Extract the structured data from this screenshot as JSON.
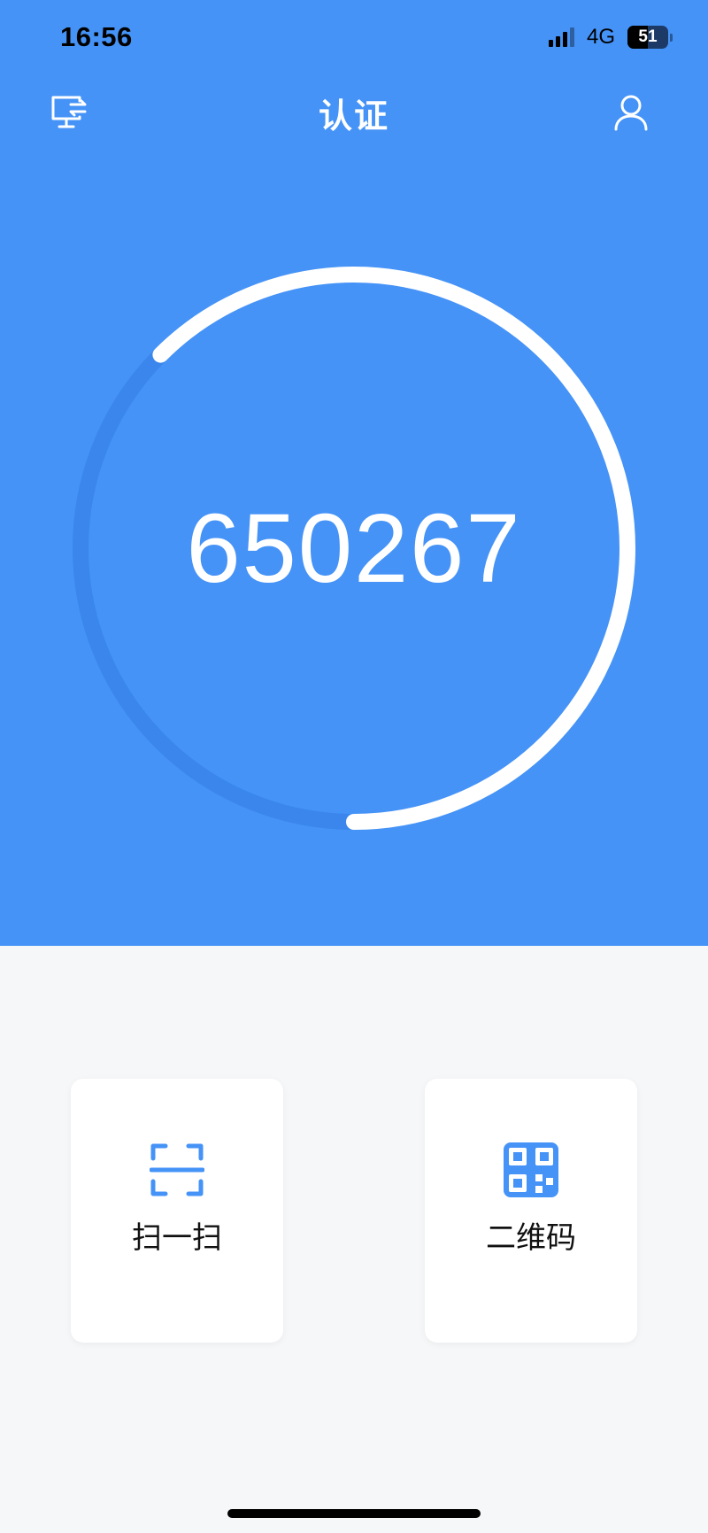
{
  "status_bar": {
    "time": "16:56",
    "network": "4G",
    "battery_level": "51",
    "battery_fraction": 0.51
  },
  "header": {
    "title": "认证",
    "left_icon": "device-transfer-icon",
    "right_icon": "user-icon"
  },
  "auth": {
    "code": "650267",
    "remaining_fraction": 0.625
  },
  "actions": [
    {
      "label": "扫一扫",
      "icon": "scan-icon"
    },
    {
      "label": "二维码",
      "icon": "qr-code-icon"
    }
  ],
  "colors": {
    "primary": "#4593f7",
    "ring_track": "#3a86ec",
    "ring_progress": "#ffffff",
    "background": "#f6f7f9"
  }
}
